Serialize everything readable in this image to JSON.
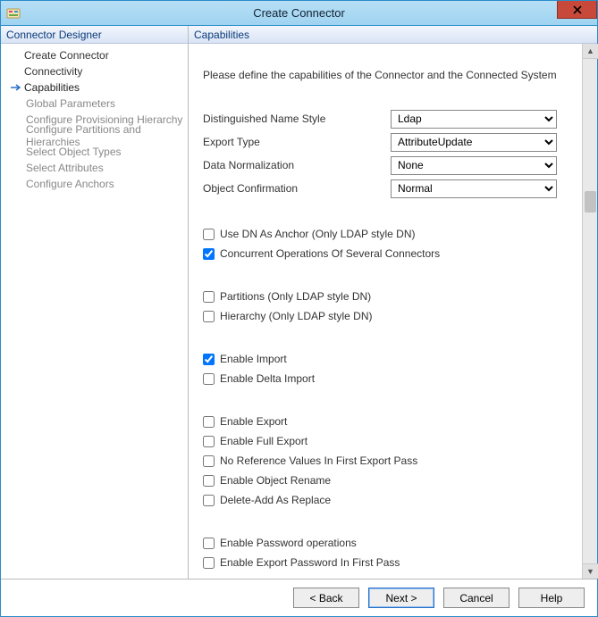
{
  "window": {
    "title": "Create Connector"
  },
  "sidebar": {
    "header": "Connector Designer",
    "items": [
      {
        "label": "Create Connector",
        "current": false,
        "sub": false
      },
      {
        "label": "Connectivity",
        "current": false,
        "sub": false
      },
      {
        "label": "Capabilities",
        "current": true,
        "sub": false
      },
      {
        "label": "Global Parameters",
        "current": false,
        "sub": true
      },
      {
        "label": "Configure Provisioning Hierarchy",
        "current": false,
        "sub": true
      },
      {
        "label": "Configure Partitions and Hierarchies",
        "current": false,
        "sub": true
      },
      {
        "label": "Select Object Types",
        "current": false,
        "sub": true
      },
      {
        "label": "Select Attributes",
        "current": false,
        "sub": true
      },
      {
        "label": "Configure Anchors",
        "current": false,
        "sub": true
      }
    ]
  },
  "panel": {
    "header": "Capabilities",
    "instruction": "Please define the capabilities of the Connector and the Connected System",
    "selects": {
      "dn_style": {
        "label": "Distinguished Name Style",
        "value": "Ldap"
      },
      "export_type": {
        "label": "Export Type",
        "value": "AttributeUpdate"
      },
      "data_norm": {
        "label": "Data Normalization",
        "value": "None"
      },
      "obj_confirm": {
        "label": "Object Confirmation",
        "value": "Normal"
      }
    },
    "checks": {
      "g1": [
        {
          "key": "use_dn_anchor",
          "label": "Use DN As Anchor (Only LDAP style DN)",
          "checked": false
        },
        {
          "key": "concurrent_ops",
          "label": "Concurrent Operations Of Several Connectors",
          "checked": true
        }
      ],
      "g2": [
        {
          "key": "partitions",
          "label": "Partitions (Only LDAP style DN)",
          "checked": false
        },
        {
          "key": "hierarchy",
          "label": "Hierarchy (Only LDAP style DN)",
          "checked": false
        }
      ],
      "g3": [
        {
          "key": "enable_import",
          "label": "Enable Import",
          "checked": true
        },
        {
          "key": "enable_delta_import",
          "label": "Enable Delta Import",
          "checked": false
        }
      ],
      "g4": [
        {
          "key": "enable_export",
          "label": "Enable Export",
          "checked": false
        },
        {
          "key": "enable_full_export",
          "label": "Enable Full Export",
          "checked": false
        },
        {
          "key": "no_ref_first_pass",
          "label": "No Reference Values In First Export Pass",
          "checked": false
        },
        {
          "key": "enable_obj_rename",
          "label": "Enable Object Rename",
          "checked": false
        },
        {
          "key": "delete_add_replace",
          "label": "Delete-Add As Replace",
          "checked": false
        }
      ],
      "g5": [
        {
          "key": "enable_pwd_ops",
          "label": "Enable Password operations",
          "checked": false
        },
        {
          "key": "enable_export_pwd_first",
          "label": "Enable Export Password In First Pass",
          "checked": false
        }
      ]
    }
  },
  "buttons": {
    "back": "<  Back",
    "next": "Next  >",
    "cancel": "Cancel",
    "help": "Help"
  }
}
